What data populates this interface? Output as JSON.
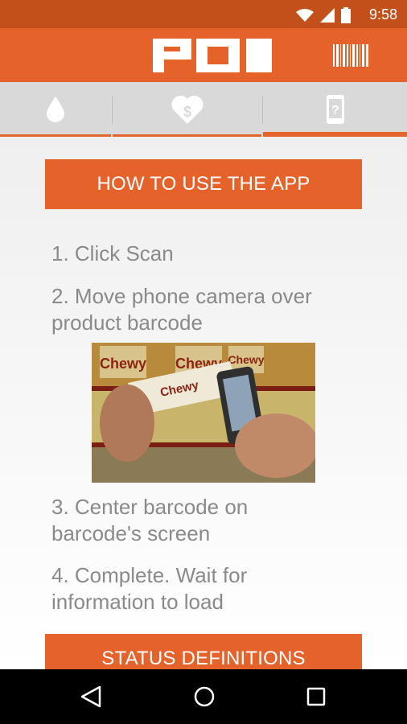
{
  "status_bar": {
    "time": "9:58"
  },
  "header": {
    "logo_text": "POI"
  },
  "tabs": [
    {
      "icon": "drop-icon"
    },
    {
      "icon": "heart-dollar-icon"
    },
    {
      "icon": "phone-help-icon",
      "active": true
    }
  ],
  "main": {
    "how_to_button": "HOW TO USE THE APP",
    "steps": [
      {
        "line1": "1. Click Scan",
        "line2": ""
      },
      {
        "line1": "2. Move phone camera over",
        "line2": "product barcode"
      },
      {
        "line1": "3. Center barcode on",
        "line2": "barcode's screen"
      },
      {
        "line1": "4. Complete. Wait for",
        "line2": "information to load"
      }
    ],
    "status_definitions_button": "STATUS DEFINITIONS",
    "photo_labels": [
      "Chewy",
      "Chewy",
      "Chewy",
      "Chewy"
    ]
  },
  "colors": {
    "brand": "#e5622a",
    "status": "#c3501b",
    "step_text": "#8a8a8a"
  }
}
